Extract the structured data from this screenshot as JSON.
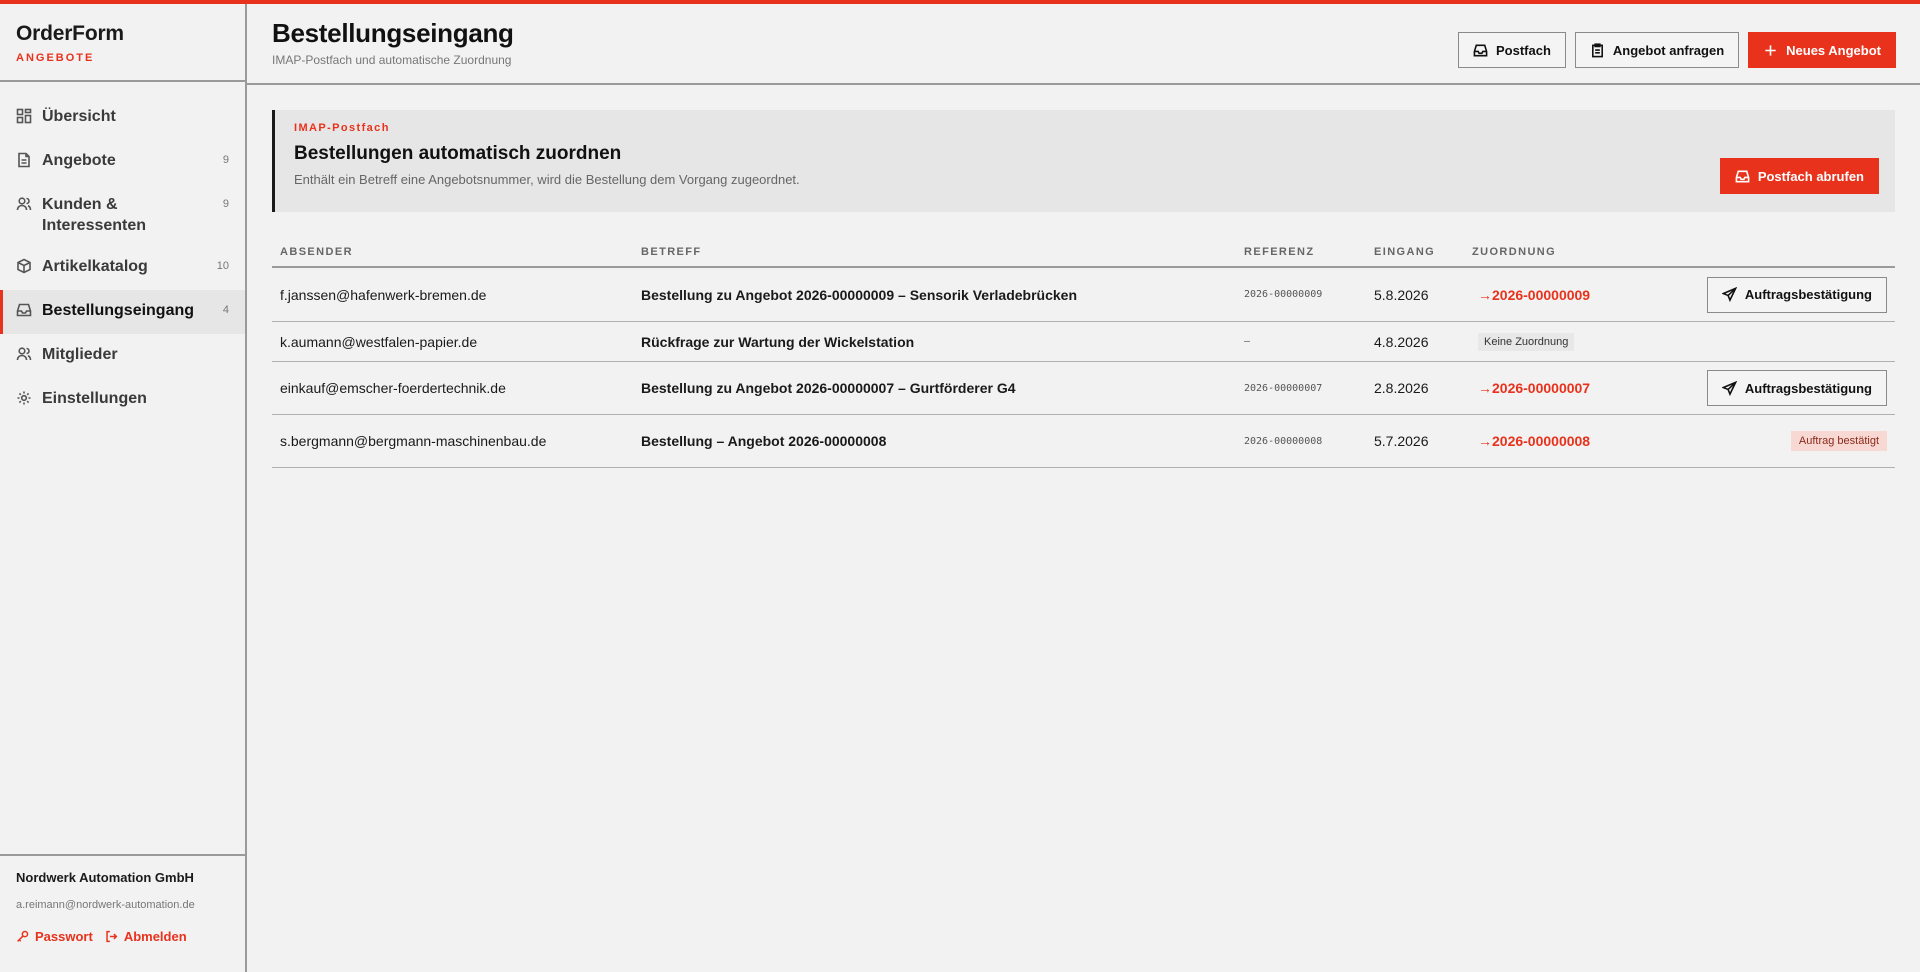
{
  "app": {
    "name": "OrderForm",
    "subtitle": "ANGEBOTE"
  },
  "colors": {
    "accent": "#e8321c",
    "text": "#1a1a1a",
    "background": "#f2f2f2"
  },
  "sidebar": {
    "items": [
      {
        "label": "Übersicht",
        "count": "",
        "icon": "dashboard-icon"
      },
      {
        "label": "Angebote",
        "count": "9",
        "icon": "document-icon"
      },
      {
        "label": "Kunden & Interessenten",
        "count": "9",
        "icon": "users-icon"
      },
      {
        "label": "Artikelkatalog",
        "count": "10",
        "icon": "box-icon"
      },
      {
        "label": "Bestellungseingang",
        "count": "4",
        "icon": "inbox-icon"
      },
      {
        "label": "Mitglieder",
        "count": "",
        "icon": "members-icon"
      },
      {
        "label": "Einstellungen",
        "count": "",
        "icon": "gear-icon"
      }
    ],
    "footer": {
      "company": "Nordwerk Automation GmbH",
      "email": "a.reimann@nordwerk-automation.de",
      "password_label": "Passwort",
      "logout_label": "Abmelden"
    }
  },
  "header": {
    "title": "Bestellungseingang",
    "subtitle": "IMAP-Postfach und automatische Zuordnung",
    "actions": {
      "inbox": "Postfach",
      "request": "Angebot anfragen",
      "new_quote": "Neues Angebot"
    }
  },
  "banner": {
    "kicker": "IMAP-Postfach",
    "title": "Bestellungen automatisch zuordnen",
    "text": "Enthält ein Betreff eine Angebotsnummer, wird die Bestellung dem Vorgang zugeordnet.",
    "button": "Postfach abrufen"
  },
  "table": {
    "columns": [
      "ABSENDER",
      "BETREFF",
      "REFERENZ",
      "EINGANG",
      "ZUORDNUNG",
      ""
    ],
    "confirm_label": "Auftragsbestätigung",
    "rows": [
      {
        "sender": "f.janssen@hafenwerk-bremen.de",
        "subject": "Bestellung zu Angebot 2026-00000009 – Sensorik Verladebrücken",
        "ref": "2026-00000009",
        "date": "5.8.2026",
        "assign": "→2026-00000009",
        "tag": "",
        "status": ""
      },
      {
        "sender": "k.aumann@westfalen-papier.de",
        "subject": "Rückfrage zur Wartung der Wickelstation",
        "ref": "–",
        "date": "4.8.2026",
        "assign": "",
        "tag": "Keine Zuordnung",
        "status": ""
      },
      {
        "sender": "einkauf@emscher-foerdertechnik.de",
        "subject": "Bestellung zu Angebot 2026-00000007 – Gurtförderer G4",
        "ref": "2026-00000007",
        "date": "2.8.2026",
        "assign": "→2026-00000007",
        "tag": "",
        "status": ""
      },
      {
        "sender": "s.bergmann@bergmann-maschinenbau.de",
        "subject": "Bestellung – Angebot 2026-00000008",
        "ref": "2026-00000008",
        "date": "5.7.2026",
        "assign": "→2026-00000008",
        "tag": "",
        "status": "Auftrag bestätigt"
      }
    ]
  }
}
